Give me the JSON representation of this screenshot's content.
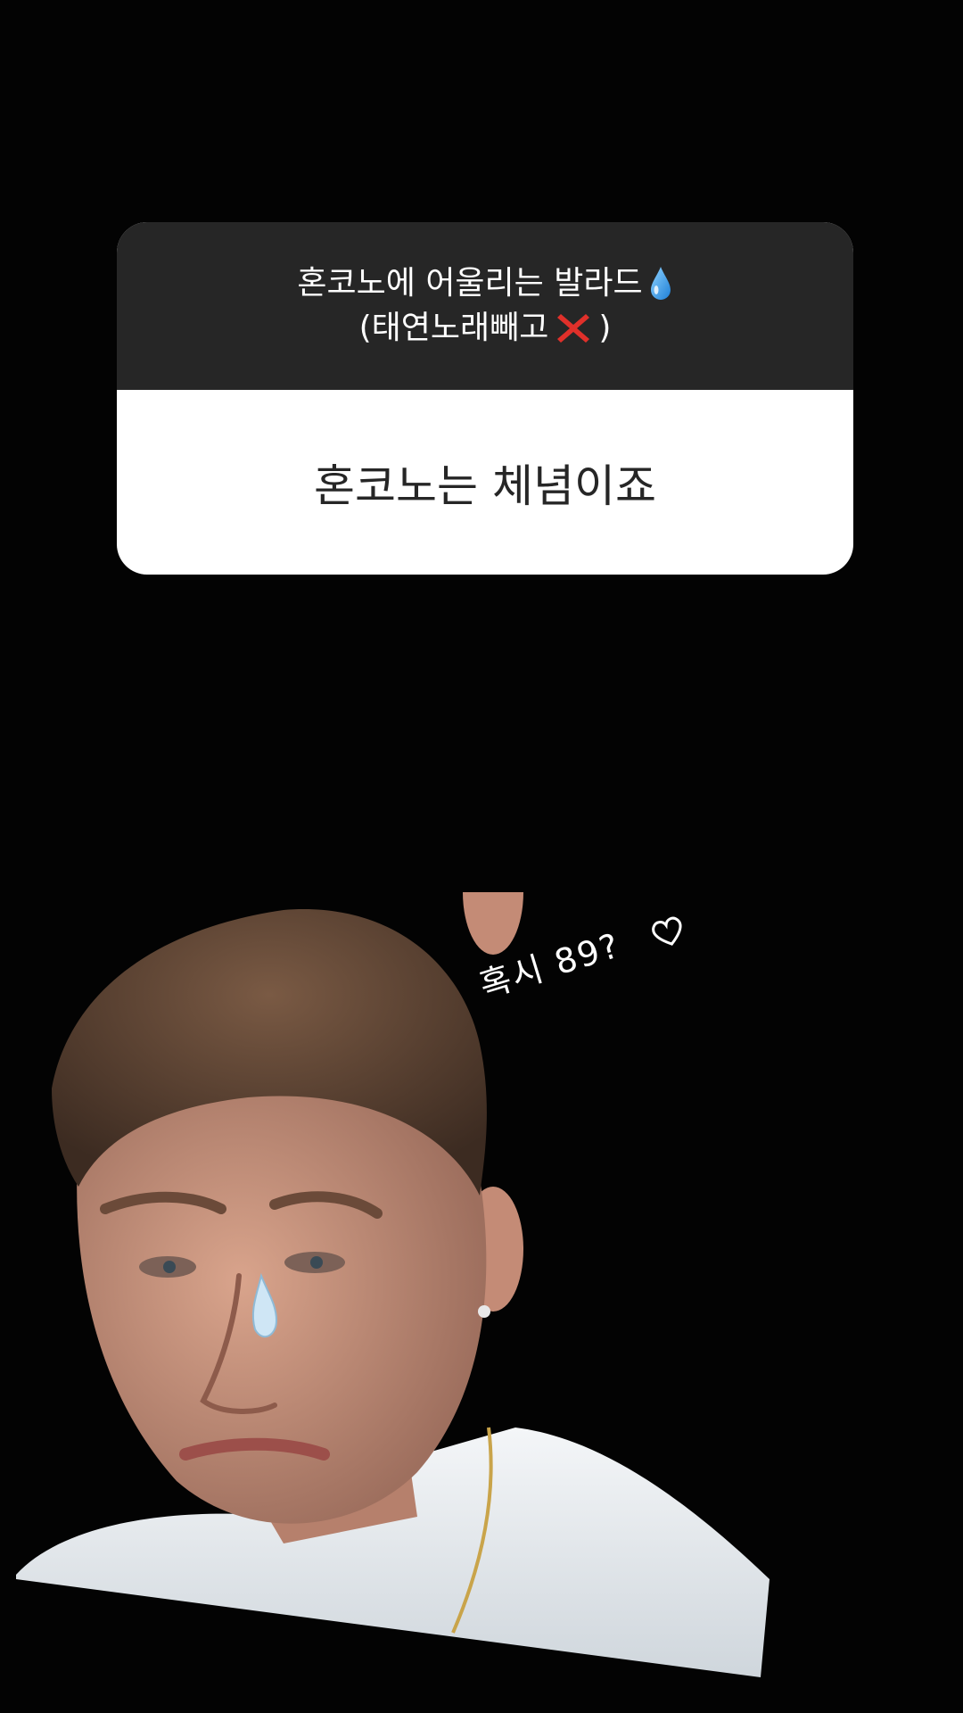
{
  "question_sticker": {
    "question_line1": "혼코노에 어울리는 발라드",
    "question_line2_prefix": "(태연노래빼고",
    "question_line2_suffix": ")",
    "answer": "혼코노는 체념이죠"
  },
  "caption": {
    "text": "혹시 89?"
  },
  "icons": {
    "drop": "droplet-icon",
    "cross": "red-cross-icon",
    "heart": "heart-outline-icon"
  },
  "colors": {
    "background": "#000000",
    "card_header": "#262626",
    "card_body": "#ffffff",
    "cross_red": "#e0302a",
    "drop_blue": "#3fa7f0"
  }
}
